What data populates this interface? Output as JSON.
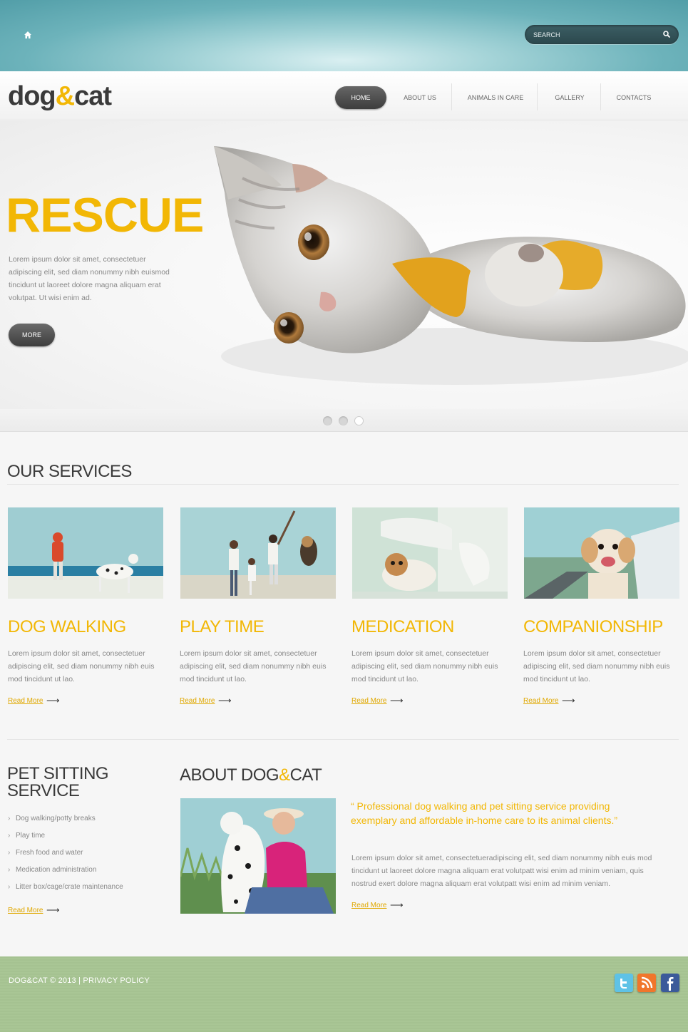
{
  "topbar": {
    "search_placeholder": "SEARCH"
  },
  "logo": {
    "part1": "dog",
    "amp": "&",
    "part2": "cat"
  },
  "nav": {
    "items": [
      "HOME",
      "ABOUT US",
      "ANIMALS IN CARE",
      "GALLERY",
      "CONTACTS"
    ],
    "active": "HOME"
  },
  "hero": {
    "title": "RESCUE",
    "text": "Lorem ipsum dolor sit amet, consectetuer adipiscing elit, sed diam nonummy nibh euismod tincidunt ut laoreet dolore magna aliquam erat volutpat. Ut wisi enim ad.",
    "button": "MORE",
    "slides": 3
  },
  "services": {
    "title": "OUR SERVICES",
    "items": [
      {
        "title": "DOG WALKING",
        "text": "Lorem ipsum dolor sit amet, consectetuer adipiscing elit, sed diam nonummy nibh euis mod tincidunt ut lao.",
        "link": "Read More"
      },
      {
        "title": "PLAY TIME",
        "text": "Lorem ipsum dolor sit amet, consectetuer adipiscing elit, sed diam nonummy nibh euis mod tincidunt ut lao.",
        "link": "Read More"
      },
      {
        "title": "MEDICATION",
        "text": "Lorem ipsum dolor sit amet, consectetuer adipiscing elit, sed diam nonummy nibh euis mod tincidunt ut lao.",
        "link": "Read More"
      },
      {
        "title": "COMPANIONSHIP",
        "text": "Lorem ipsum dolor sit amet, consectetuer adipiscing elit, sed diam nonummy nibh euis mod tincidunt ut lao.",
        "link": "Read More"
      }
    ]
  },
  "pet_sitting": {
    "title_line1": "PET SITTING",
    "title_line2": "SERVICE",
    "items": [
      "Dog walking/potty breaks",
      "Play time",
      "Fresh food and water",
      "Medication administration",
      "Litter box/cage/crate maintenance"
    ],
    "link": "Read More"
  },
  "about": {
    "title_a": "ABOUT DOG",
    "title_amp": "&",
    "title_b": "CAT",
    "quote": "“ Professional dog walking and pet sitting service providing exemplary and affordable in-home care to its animal clients.”",
    "text": "Lorem ipsum dolor sit amet, consectetueradipiscing elit, sed diam nonummy nibh euis mod tincidunt ut laoreet dolore magna aliquam erat volutpatt wisi enim ad minim veniam, quis nostrud exert dolore magna aliquam erat volutpatt wisi enim ad minim veniam.",
    "link": "Read More"
  },
  "footer": {
    "text": "DOG&CAT © 2013 | PRIVACY POLICY",
    "social": [
      "twitter-icon",
      "rss-icon",
      "facebook-icon"
    ]
  },
  "colors": {
    "accent": "#f2b705",
    "dark": "#3a3a3a",
    "teal": "#6db3bb",
    "footer_green": "#a5c291"
  }
}
